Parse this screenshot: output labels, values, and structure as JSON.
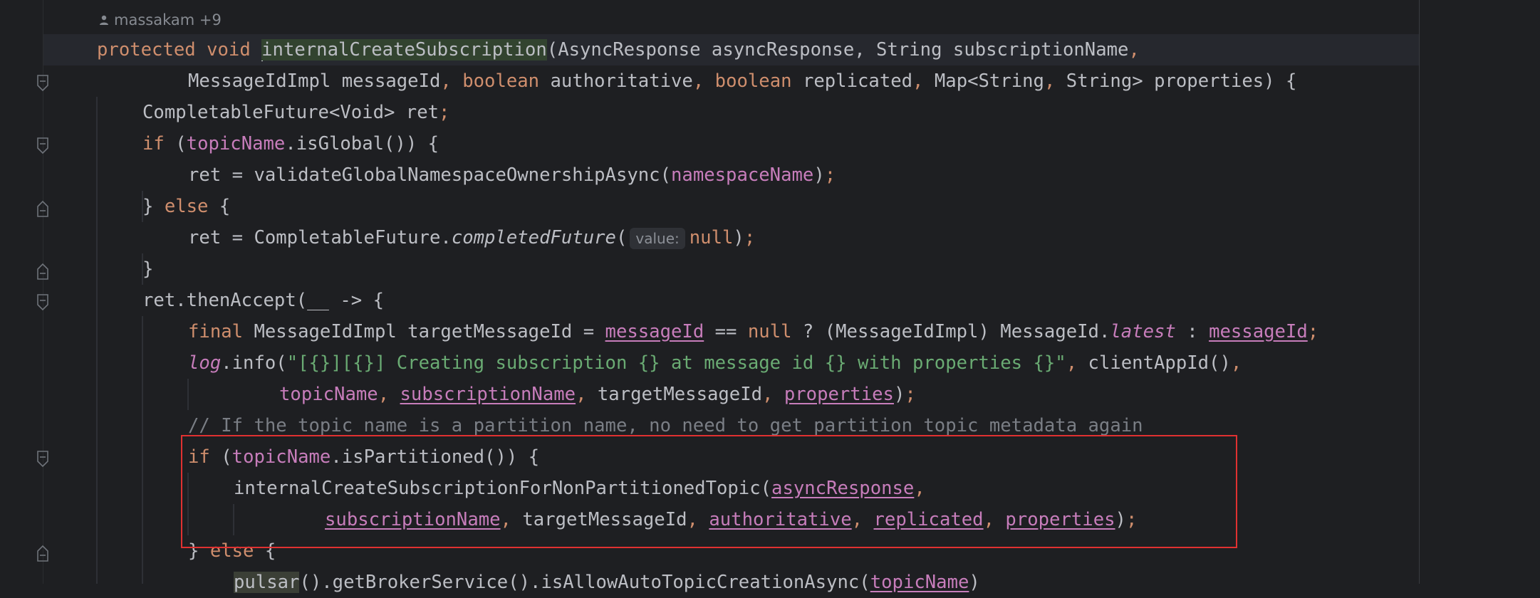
{
  "author_hint": {
    "text": "massakam +9",
    "icon": "person-icon"
  },
  "colors": {
    "keyword": "#cf8e6d",
    "field": "#c77dbb",
    "string": "#6aab73",
    "comment": "#7a7e85",
    "plain": "#bcbec4",
    "highlight_box": "#e03131"
  },
  "code": {
    "l1": {
      "kw": "protected void ",
      "method": "internalCreateSubscription",
      "rest": "(AsyncResponse asyncResponse, String subscriptionName",
      "comma": ","
    },
    "l2": {
      "a": "MessageIdImpl messageId",
      "c1": ", ",
      "b1": "boolean",
      "a2": " authoritative",
      "c2": ", ",
      "b2": "boolean",
      "a3": " replicated",
      "c3": ", ",
      "a4": "Map<String",
      "c4": ", ",
      "a5": "String> properties) {"
    },
    "l3": {
      "a": "CompletableFuture<Void> ret",
      "semi": ";"
    },
    "l4": {
      "kw": "if",
      "a": " (",
      "fld": "topicName",
      "b": ".isGlobal()) {"
    },
    "l5": {
      "a": "ret = validateGlobalNamespaceOwnershipAsync(",
      "fld": "namespaceName",
      "b": ")",
      "semi": ";"
    },
    "l6": {
      "a": "} ",
      "kw": "else",
      "b": " {"
    },
    "l7": {
      "a": "ret = CompletableFuture.",
      "ital": "completedFuture",
      "b": "(",
      "hint": "value:",
      "kw": "null",
      "c": ")",
      "semi": ";"
    },
    "l8": {
      "a": "}"
    },
    "l9": {
      "a": "ret.thenAccept(__ -> {"
    },
    "l10": {
      "kw": "final",
      "a": " MessageIdImpl targetMessageId = ",
      "f1": "messageId",
      "b": " == ",
      "kw2": "null",
      "c": " ? (MessageIdImpl) MessageId.",
      "f2": "latest",
      "d": " : ",
      "f3": "messageId",
      "semi": ";"
    },
    "l11": {
      "f1": "log",
      "a": ".info(",
      "str": "\"[{}][{}] Creating subscription {} at message id {} with properties {}\"",
      "c1": ",",
      "b": " clientAppId()",
      "c2": ","
    },
    "l12": {
      "f1": "topicName",
      "c1": ", ",
      "f2": "subscriptionName",
      "c2": ",",
      "a": " targetMessageId",
      "c3": ", ",
      "f3": "properties",
      "b": ")",
      "semi": ";"
    },
    "l13": {
      "cmt": "// If the topic name is a partition name, no need to get partition topic metadata again"
    },
    "l14": {
      "kw": "if",
      "a": " (",
      "fld": "topicName",
      "b": ".isPartitioned()) {"
    },
    "l15": {
      "a": "internalCreateSubscriptionForNonPartitionedTopic(",
      "f1": "asyncResponse",
      "c": ","
    },
    "l16": {
      "f1": "subscriptionName",
      "c1": ",",
      "a": " targetMessageId",
      "c2": ", ",
      "f2": "authoritative",
      "c3": ", ",
      "f3": "replicated",
      "c4": ", ",
      "f4": "properties",
      "b": ")",
      "semi": ";"
    },
    "l17": {
      "a": "} ",
      "kw": "else",
      "b": " {"
    },
    "l18": {
      "hl": "pulsar",
      "a": "().getBrokerService().isAllowAutoTopicCreationAsync(",
      "fld": "topicName",
      "b": ")"
    }
  }
}
